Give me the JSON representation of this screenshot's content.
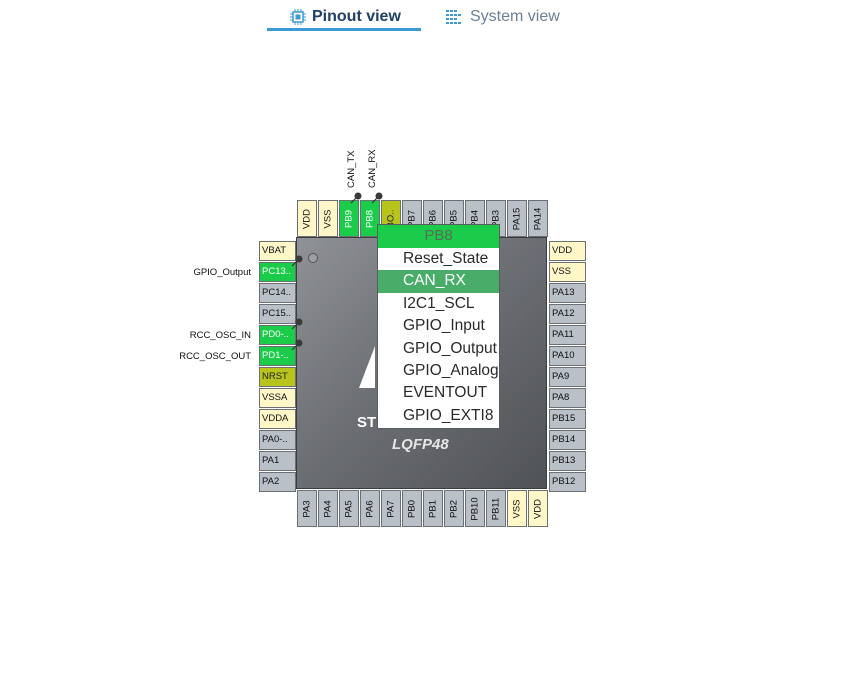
{
  "tabs": {
    "pinout": {
      "label": "Pinout view",
      "icon": "chip-icon"
    },
    "system": {
      "label": "System view",
      "icon": "grid-icon"
    }
  },
  "chip": {
    "brand": "ST",
    "package": "LQFP48"
  },
  "pins": {
    "top": [
      {
        "label": "VDD",
        "state": "power"
      },
      {
        "label": "VSS",
        "state": "power"
      },
      {
        "label": "PB9",
        "state": "assigned"
      },
      {
        "label": "PB8",
        "state": "assigned"
      },
      {
        "label": "BO..",
        "state": "fixed"
      },
      {
        "label": "PB7",
        "state": "free"
      },
      {
        "label": "PB6",
        "state": "free"
      },
      {
        "label": "PB5",
        "state": "free"
      },
      {
        "label": "PB4",
        "state": "free"
      },
      {
        "label": "PB3",
        "state": "free"
      },
      {
        "label": "PA15",
        "state": "free"
      },
      {
        "label": "PA14",
        "state": "free"
      }
    ],
    "left": [
      {
        "label": "VBAT",
        "state": "power"
      },
      {
        "label": "PC13..",
        "state": "assigned"
      },
      {
        "label": "PC14..",
        "state": "free"
      },
      {
        "label": "PC15..",
        "state": "free"
      },
      {
        "label": "PD0-..",
        "state": "assigned"
      },
      {
        "label": "PD1-..",
        "state": "assigned"
      },
      {
        "label": "NRST",
        "state": "fixed"
      },
      {
        "label": "VSSA",
        "state": "power"
      },
      {
        "label": "VDDA",
        "state": "power"
      },
      {
        "label": "PA0-..",
        "state": "free"
      },
      {
        "label": "PA1",
        "state": "free"
      },
      {
        "label": "PA2",
        "state": "free"
      }
    ],
    "right": [
      {
        "label": "VDD",
        "state": "power"
      },
      {
        "label": "VSS",
        "state": "power"
      },
      {
        "label": "PA13",
        "state": "free"
      },
      {
        "label": "PA12",
        "state": "free"
      },
      {
        "label": "PA11",
        "state": "free"
      },
      {
        "label": "PA10",
        "state": "free"
      },
      {
        "label": "PA9",
        "state": "free"
      },
      {
        "label": "PA8",
        "state": "free"
      },
      {
        "label": "PB15",
        "state": "free"
      },
      {
        "label": "PB14",
        "state": "free"
      },
      {
        "label": "PB13",
        "state": "free"
      },
      {
        "label": "PB12",
        "state": "free"
      }
    ],
    "bottom": [
      {
        "label": "PA3",
        "state": "free"
      },
      {
        "label": "PA4",
        "state": "free"
      },
      {
        "label": "PA5",
        "state": "free"
      },
      {
        "label": "PA6",
        "state": "free"
      },
      {
        "label": "PA7",
        "state": "free"
      },
      {
        "label": "PB0",
        "state": "free"
      },
      {
        "label": "PB1",
        "state": "free"
      },
      {
        "label": "PB2",
        "state": "free"
      },
      {
        "label": "PB10",
        "state": "free"
      },
      {
        "label": "PB11",
        "state": "free"
      },
      {
        "label": "VSS",
        "state": "power"
      },
      {
        "label": "VDD",
        "state": "power"
      }
    ]
  },
  "signal_labels": {
    "pc13": "GPIO_Output",
    "pd0": "RCC_OSC_IN",
    "pd1": "RCC_OSC_OUT",
    "pb9": "CAN_TX",
    "pb8": "CAN_RX"
  },
  "pin_menu": {
    "title": "PB8",
    "items": [
      "Reset_State",
      "CAN_RX",
      "I2C1_SCL",
      "GPIO_Input",
      "GPIO_Output",
      "GPIO_Analog",
      "EVENTOUT",
      "GPIO_EXTI8"
    ],
    "selected": "CAN_RX"
  },
  "colors": {
    "assigned": "#1bcc4a",
    "power": "#fff7c8",
    "fixed": "#b8c41c",
    "free": "#b9c0c7",
    "menu_selected": "#49ad69",
    "tab_underline": "#3c9ad6"
  }
}
